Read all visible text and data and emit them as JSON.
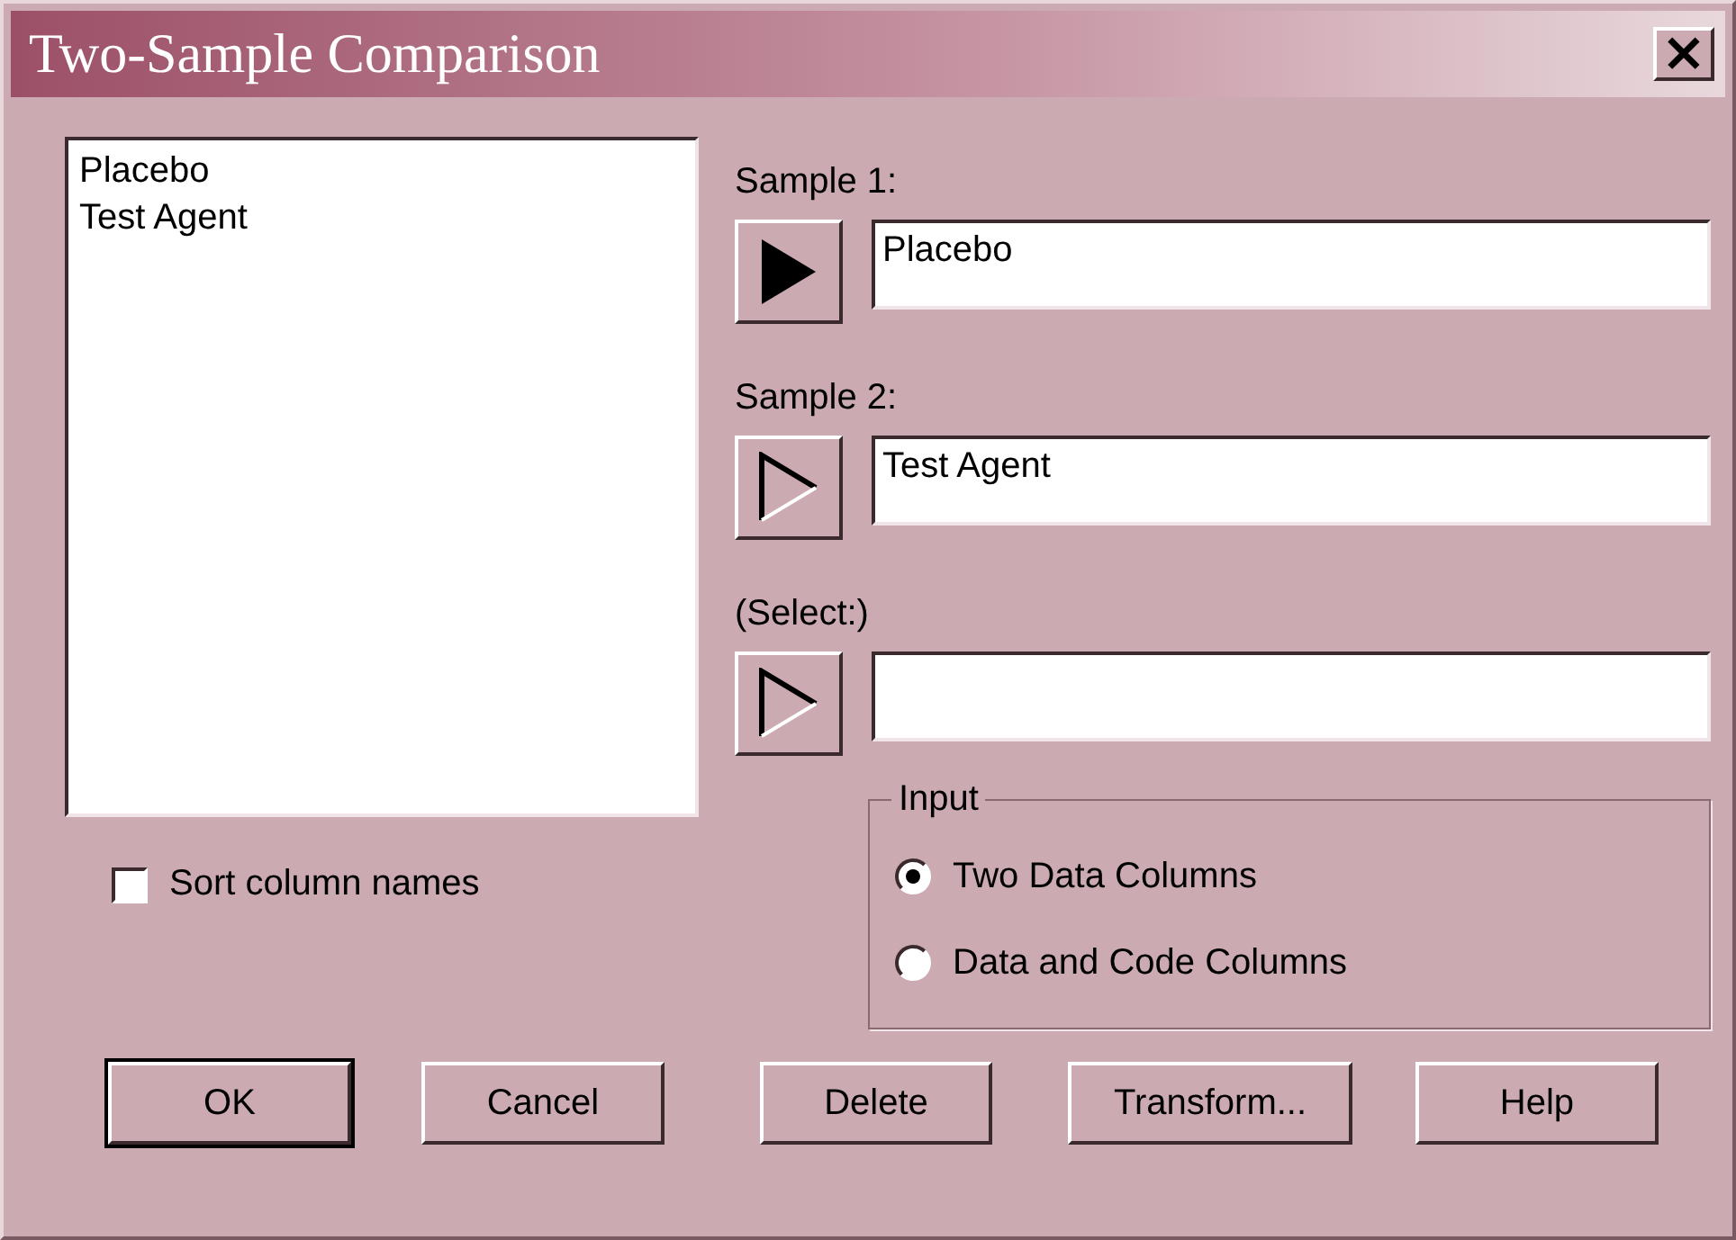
{
  "window": {
    "title": "Two-Sample Comparison",
    "close": "×"
  },
  "column_list": {
    "items": [
      {
        "label": "Placebo",
        "selected": false
      },
      {
        "label": "Test Agent",
        "selected": false
      }
    ]
  },
  "samples": [
    {
      "label": "Sample 1:",
      "value": "Placebo",
      "active": true
    },
    {
      "label": "Sample 2:",
      "value": "Test Agent",
      "active": false
    },
    {
      "label": "(Select:)",
      "active": false
    }
  ],
  "sort_column_names": {
    "label": "Sort column names",
    "checked": false
  },
  "input": {
    "title": "Input",
    "options": [
      {
        "label": "Two Data Columns",
        "selected": true
      },
      {
        "label": "Data and Code Columns",
        "selected": false
      }
    ]
  },
  "buttons": [
    {
      "label": "OK",
      "default": true
    },
    {
      "label": "Cancel",
      "default": false
    },
    {
      "label": "Delete",
      "default": false
    },
    {
      "label": "Transform...",
      "default": false
    },
    {
      "label": "Help",
      "default": false
    }
  ]
}
